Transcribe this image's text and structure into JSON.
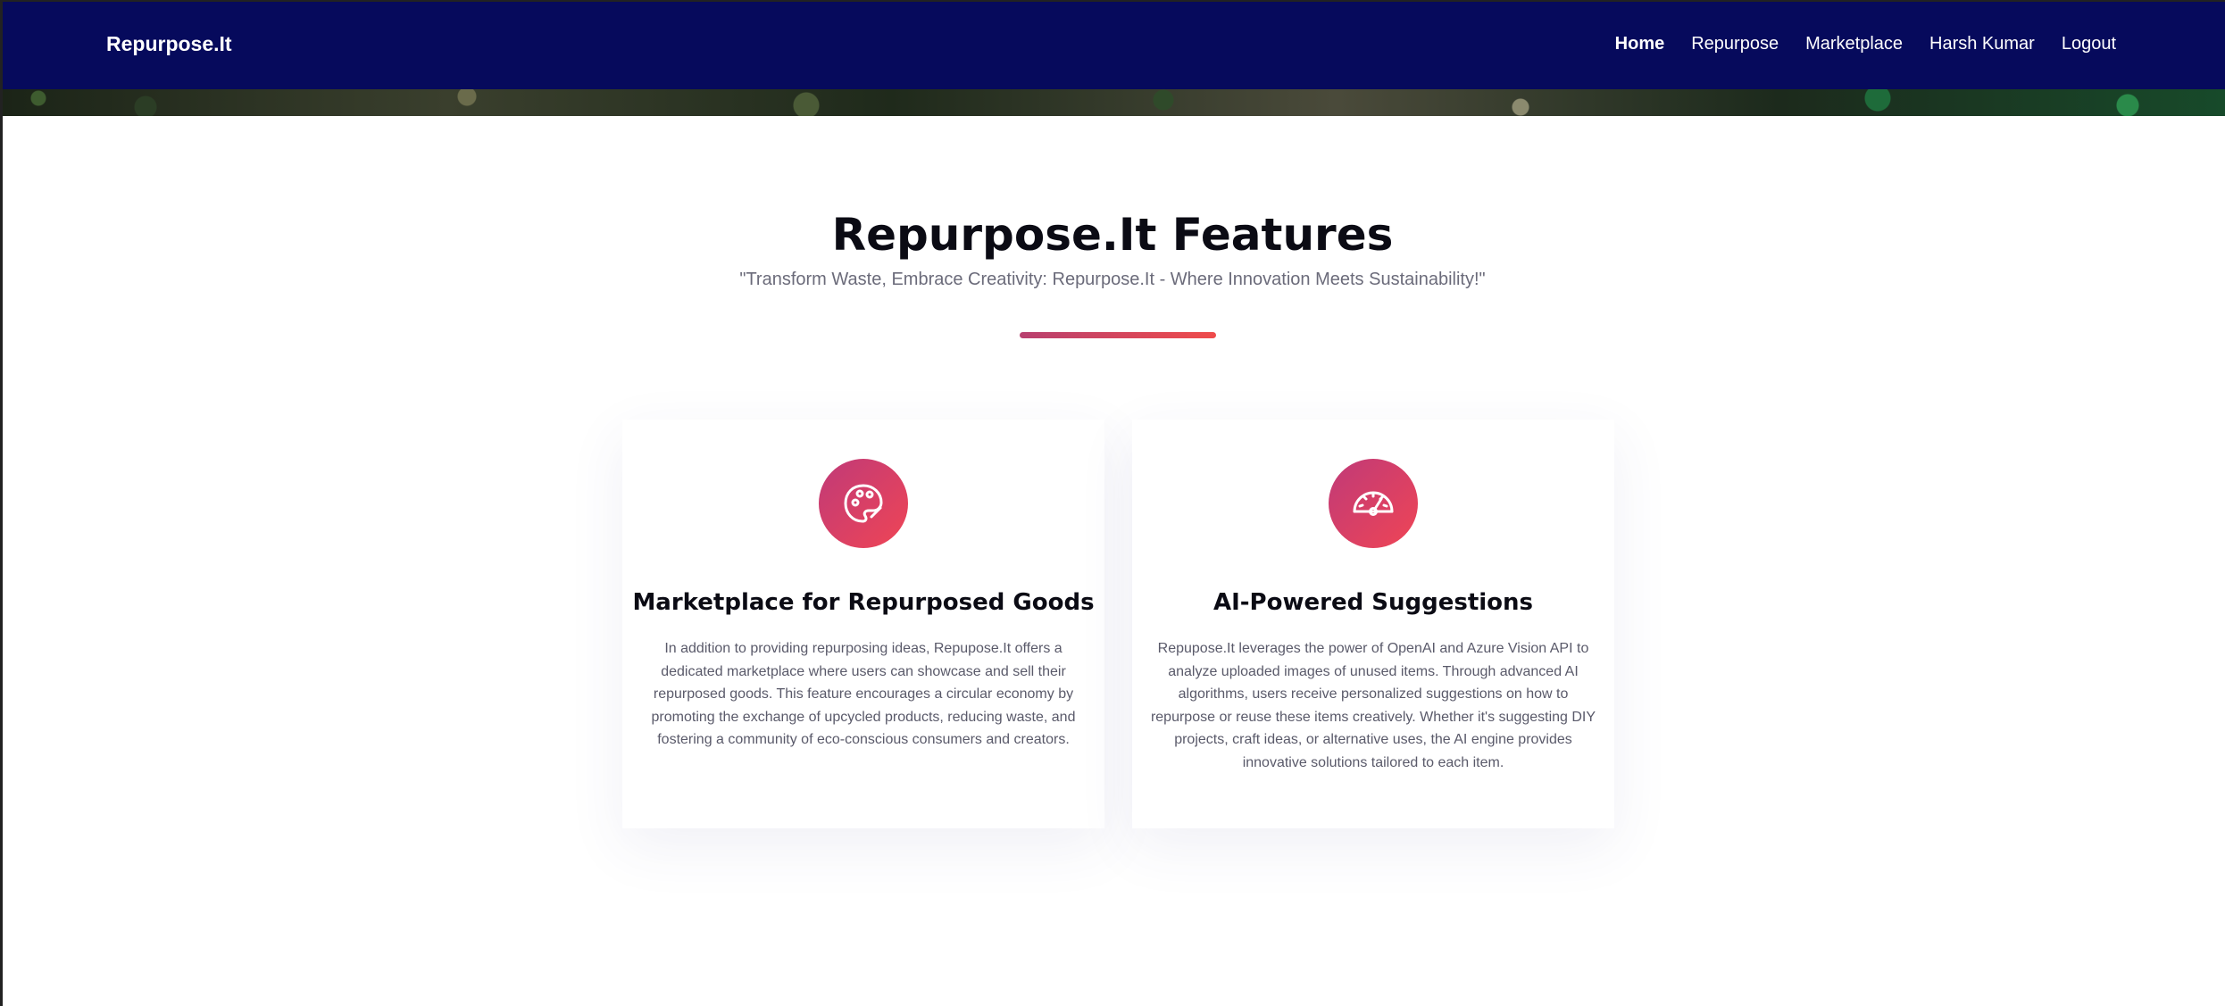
{
  "header": {
    "brand": "Repurpose.It",
    "nav": [
      {
        "label": "Home",
        "active": true
      },
      {
        "label": "Repurpose",
        "active": false
      },
      {
        "label": "Marketplace",
        "active": false
      },
      {
        "label": "Harsh Kumar",
        "active": false
      },
      {
        "label": "Logout",
        "active": false
      }
    ]
  },
  "features": {
    "title": "Repurpose.It Features",
    "subtitle": "\"Transform Waste, Embrace Creativity: Repurpose.It - Where Innovation Meets Sustainability!\"",
    "accent_colors": [
      "#b8406f",
      "#ef4b4b"
    ],
    "cards": [
      {
        "icon": "palette-icon",
        "title": "Marketplace for Repurposed Goods",
        "text": "In addition to providing repurposing ideas, Repupose.It offers a dedicated marketplace where users can showcase and sell their repurposed goods. This feature encourages a circular economy by promoting the exchange of upcycled products, reducing waste, and fostering a community of eco-conscious consumers and creators."
      },
      {
        "icon": "speedometer-icon",
        "title": "AI-Powered Suggestions",
        "text": "Repupose.It leverages the power of OpenAI and Azure Vision API to analyze uploaded images of unused items. Through advanced AI algorithms, users receive personalized suggestions on how to repurpose or reuse these items creatively. Whether it's suggesting DIY projects, craft ideas, or alternative uses, the AI engine provides innovative solutions tailored to each item."
      }
    ]
  },
  "colors": {
    "navbar_bg": "#060a5c",
    "icon_gradient": [
      "#c03a78",
      "#ef4555"
    ]
  }
}
